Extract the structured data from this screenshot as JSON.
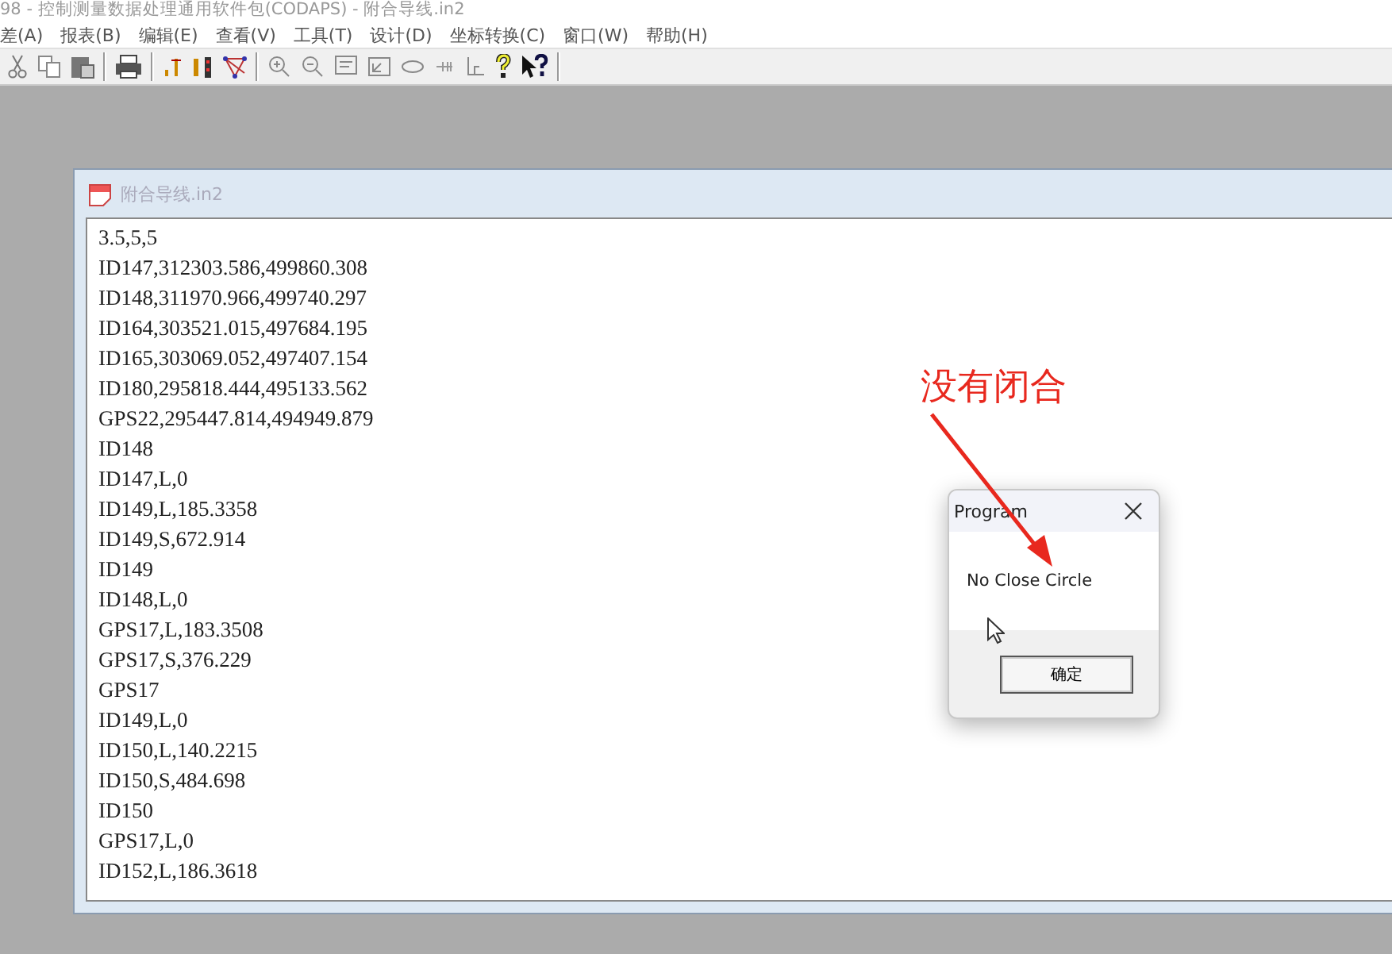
{
  "window": {
    "title": "98 - 控制测量数据处理通用软件包(CODAPS) - 附合导线.in2"
  },
  "menu": [
    "差(A)",
    "报表(B)",
    "编辑(E)",
    "查看(V)",
    "工具(T)",
    "设计(D)",
    "坐标转换(C)",
    "窗口(W)",
    "帮助(H)"
  ],
  "document": {
    "title": "附合导线.in2",
    "lines": [
      "3.5,5,5",
      "ID147,312303.586,499860.308",
      "ID148,311970.966,499740.297",
      "ID164,303521.015,497684.195",
      "ID165,303069.052,497407.154",
      "ID180,295818.444,495133.562",
      "GPS22,295447.814,494949.879",
      "ID148",
      "ID147,L,0",
      "ID149,L,185.3358",
      "ID149,S,672.914",
      "ID149",
      "ID148,L,0",
      "GPS17,L,183.3508",
      "GPS17,S,376.229",
      "GPS17",
      "ID149,L,0",
      "ID150,L,140.2215",
      "ID150,S,484.698",
      "ID150",
      "GPS17,L,0",
      "ID152,L,186.3618"
    ]
  },
  "dialog": {
    "title": "Program",
    "message": "No Close Circle",
    "button": "确定"
  },
  "annotation": {
    "text": "没有闭合"
  }
}
